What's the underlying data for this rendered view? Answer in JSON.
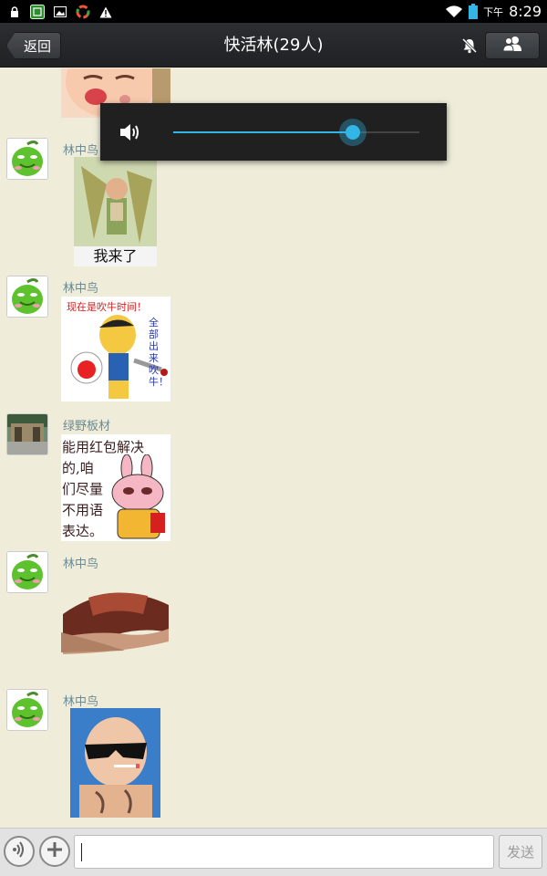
{
  "status_bar": {
    "ampm": "下午",
    "time": "8:29",
    "icons": [
      "lock-icon",
      "app-notification-icon",
      "image-icon",
      "sync-icon",
      "warning-icon",
      "wifi-icon",
      "battery-icon"
    ]
  },
  "header": {
    "back_label": "返回",
    "title": "快活林(29人)",
    "mute_icon": "bell-muted-icon",
    "members_icon": "members-icon"
  },
  "volume": {
    "icon": "speaker-icon",
    "level": 0.73,
    "accent": "#33b5e5"
  },
  "messages": [
    {
      "sender": "",
      "sticker": "crying-baby-sticker"
    },
    {
      "sender": "林中鸟",
      "sticker": "child-with-grain-sticker",
      "caption": "我来了"
    },
    {
      "sender": "林中鸟",
      "sticker": "boasting-cartoon-sticker",
      "caption": "现在是吹牛时间！",
      "side_text": "全部出来吹牛！"
    },
    {
      "sender": "绿野板材",
      "sticker": "red-envelope-rabbit-sticker",
      "text_lines": [
        "能用红包解决",
        "的,咱",
        "们尽量",
        "不用语",
        "表达。"
      ]
    },
    {
      "sender": "林中鸟",
      "sticker": "empty-wallet-sticker"
    },
    {
      "sender": "林中鸟",
      "sticker": "cool-baby-sticker"
    }
  ],
  "input_bar": {
    "voice_icon": "voice-icon",
    "plus_icon": "plus-icon",
    "input_value": "",
    "input_placeholder": "",
    "send_label": "发送"
  },
  "colors": {
    "chat_background": "#efedd9",
    "sender_name": "#6c8a93",
    "titlebar": "#25282a"
  }
}
